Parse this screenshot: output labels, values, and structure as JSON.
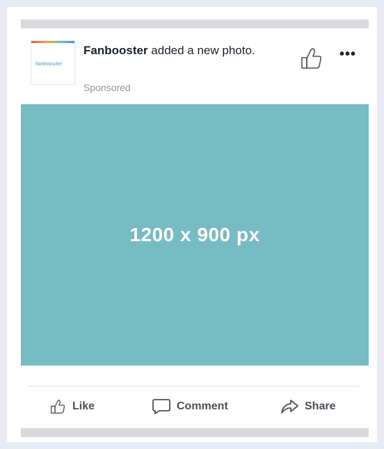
{
  "post": {
    "author": "Fanbooster",
    "action_text": " added a new photo.",
    "sponsored_label": "Sponsored",
    "avatar_logo_text": "fanbooster",
    "image_label": "1200 x 900 px"
  },
  "actions": {
    "like_label": "Like",
    "comment_label": "Comment",
    "share_label": "Share"
  },
  "header": {
    "more_label": "•••"
  },
  "colors": {
    "image_background": "#77bbc3",
    "page_background": "#e8ebf1",
    "action_text": "#4b4f56"
  }
}
